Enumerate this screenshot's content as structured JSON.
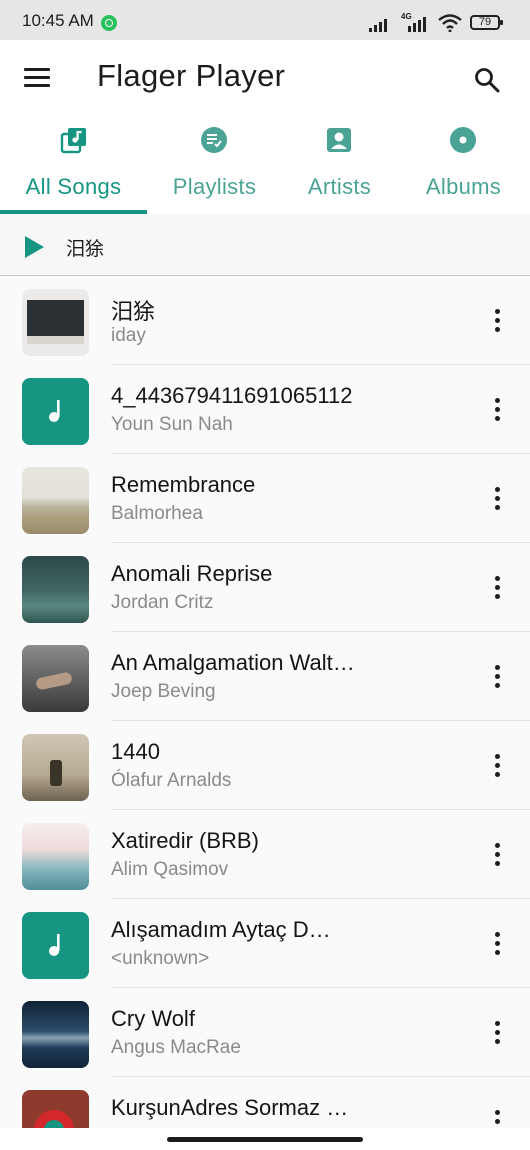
{
  "status": {
    "time": "10:45 AM",
    "network": "4G",
    "battery": "79"
  },
  "app": {
    "title": "Flager Player"
  },
  "tabs": [
    {
      "label": "All Songs",
      "icon": "music-library-icon",
      "active": true
    },
    {
      "label": "Playlists",
      "icon": "playlist-icon",
      "active": false
    },
    {
      "label": "Artists",
      "icon": "artist-icon",
      "active": false
    },
    {
      "label": "Albums",
      "icon": "album-icon",
      "active": false
    }
  ],
  "now_playing": {
    "title": "汨狳"
  },
  "songs": [
    {
      "title": "汨狳",
      "artist": "iday",
      "art": "dark-room-cover"
    },
    {
      "title": "4_443679411691065112",
      "artist": "Youn Sun Nah",
      "art": "default-note"
    },
    {
      "title": "Remembrance",
      "artist": "Balmorhea",
      "art": "desert-cover"
    },
    {
      "title": "Anomali Reprise",
      "artist": "Jordan Critz",
      "art": "teal-landscape-cover"
    },
    {
      "title": "An Amalgamation Walt…",
      "artist": "Joep Beving",
      "art": "grey-figure-cover"
    },
    {
      "title": "1440",
      "artist": "Ólafur Arnalds",
      "art": "birds-cover"
    },
    {
      "title": "Xatiredir (BRB)",
      "artist": "Alim Qasimov",
      "art": "pink-mountains-cover"
    },
    {
      "title": "Alışamadım   Aytaç D…",
      "artist": "<unknown>",
      "art": "default-note"
    },
    {
      "title": "Cry Wolf",
      "artist": "Angus MacRae",
      "art": "blue-sea-cover"
    },
    {
      "title": "KurşunAdres Sormaz …",
      "artist": "",
      "art": "red-collage-cover"
    }
  ],
  "colors": {
    "accent": "#159582",
    "tab_inactive": "#4aa395",
    "text": "#141414",
    "secondary_text": "#8a8a8a"
  }
}
